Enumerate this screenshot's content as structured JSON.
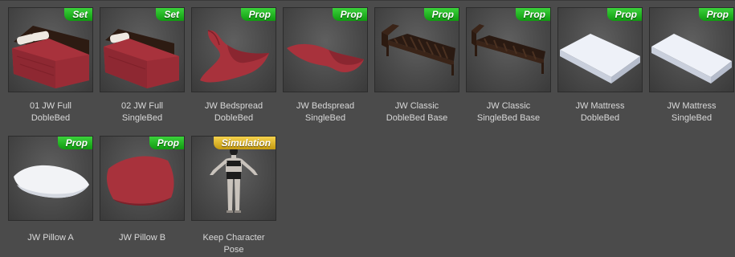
{
  "items": [
    {
      "badge": "Set",
      "line1": "01 JW Full",
      "line2": "DobleBed",
      "icon": "double-bed-icon"
    },
    {
      "badge": "Set",
      "line1": "02 JW Full",
      "line2": "SingleBed",
      "icon": "single-bed-icon"
    },
    {
      "badge": "Prop",
      "line1": "JW Bedspread",
      "line2": "DobleBed",
      "icon": "bedspread-icon"
    },
    {
      "badge": "Prop",
      "line1": "JW Bedspread",
      "line2": "SingleBed",
      "icon": "bedspread-icon"
    },
    {
      "badge": "Prop",
      "line1": "JW Classic",
      "line2": "DobleBed Base",
      "icon": "bed-frame-icon"
    },
    {
      "badge": "Prop",
      "line1": "JW Classic",
      "line2": "SingleBed Base",
      "icon": "bed-frame-icon"
    },
    {
      "badge": "Prop",
      "line1": "JW Mattress",
      "line2": "DobleBed",
      "icon": "mattress-icon"
    },
    {
      "badge": "Prop",
      "line1": "JW Mattress",
      "line2": "SingleBed",
      "icon": "mattress-icon"
    },
    {
      "badge": "Prop",
      "line1": "JW Pillow A",
      "line2": "",
      "icon": "pillow-icon"
    },
    {
      "badge": "Prop",
      "line1": "JW Pillow B",
      "line2": "",
      "icon": "pillow-icon"
    },
    {
      "badge": "Simulation",
      "line1": "Keep Character",
      "line2": "Pose",
      "icon": "figure-icon"
    }
  ],
  "colors": {
    "set_badge": "#1fb81f",
    "prop_badge": "#1fb81f",
    "simulation_badge": "#e0b020",
    "bedding_red": "#a8323c",
    "wood": "#3a2418",
    "mattress": "#e8ecf4"
  }
}
